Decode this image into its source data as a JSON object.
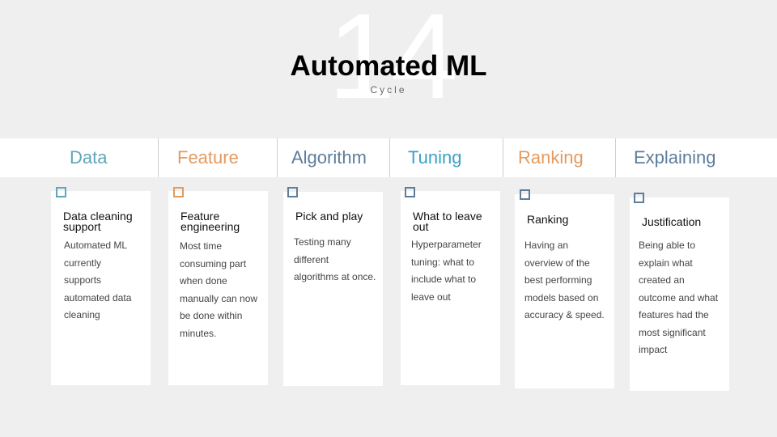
{
  "slide_number": "14",
  "title": "Automated ML",
  "subtitle": "Cycle",
  "colors": {
    "teal": "#5fa6b8",
    "orange": "#e39b5f",
    "blue": "#5d7d9c",
    "cyan": "#3aa3c6"
  },
  "stages": [
    {
      "header": "Data",
      "card_title": "Data cleaning support",
      "lines": [
        "Automated ML",
        "currently",
        "supports",
        "automated data",
        "cleaning"
      ]
    },
    {
      "header": "Feature",
      "card_title": "Feature engineering",
      "lines": [
        "Most time",
        "consuming part",
        "when done",
        "manually can now",
        "be done within",
        "minutes."
      ]
    },
    {
      "header": "Algorithm",
      "card_title": "Pick and play",
      "lines": [
        "Testing many",
        "different",
        "algorithms at once."
      ]
    },
    {
      "header": "Tuning",
      "card_title": "What to leave out",
      "lines": [
        "Hyperparameter",
        "tuning: what to",
        "include what to",
        "leave out"
      ]
    },
    {
      "header": "Ranking",
      "card_title": "Ranking",
      "lines": [
        "Having an",
        "overview of the",
        "best performing",
        "models based on",
        "accuracy & speed."
      ]
    },
    {
      "header": "Explaining",
      "card_title": "Justification",
      "lines": [
        "Being able to",
        "explain what",
        "created an",
        "outcome and what",
        "features had the",
        "most significant",
        "impact"
      ]
    }
  ]
}
